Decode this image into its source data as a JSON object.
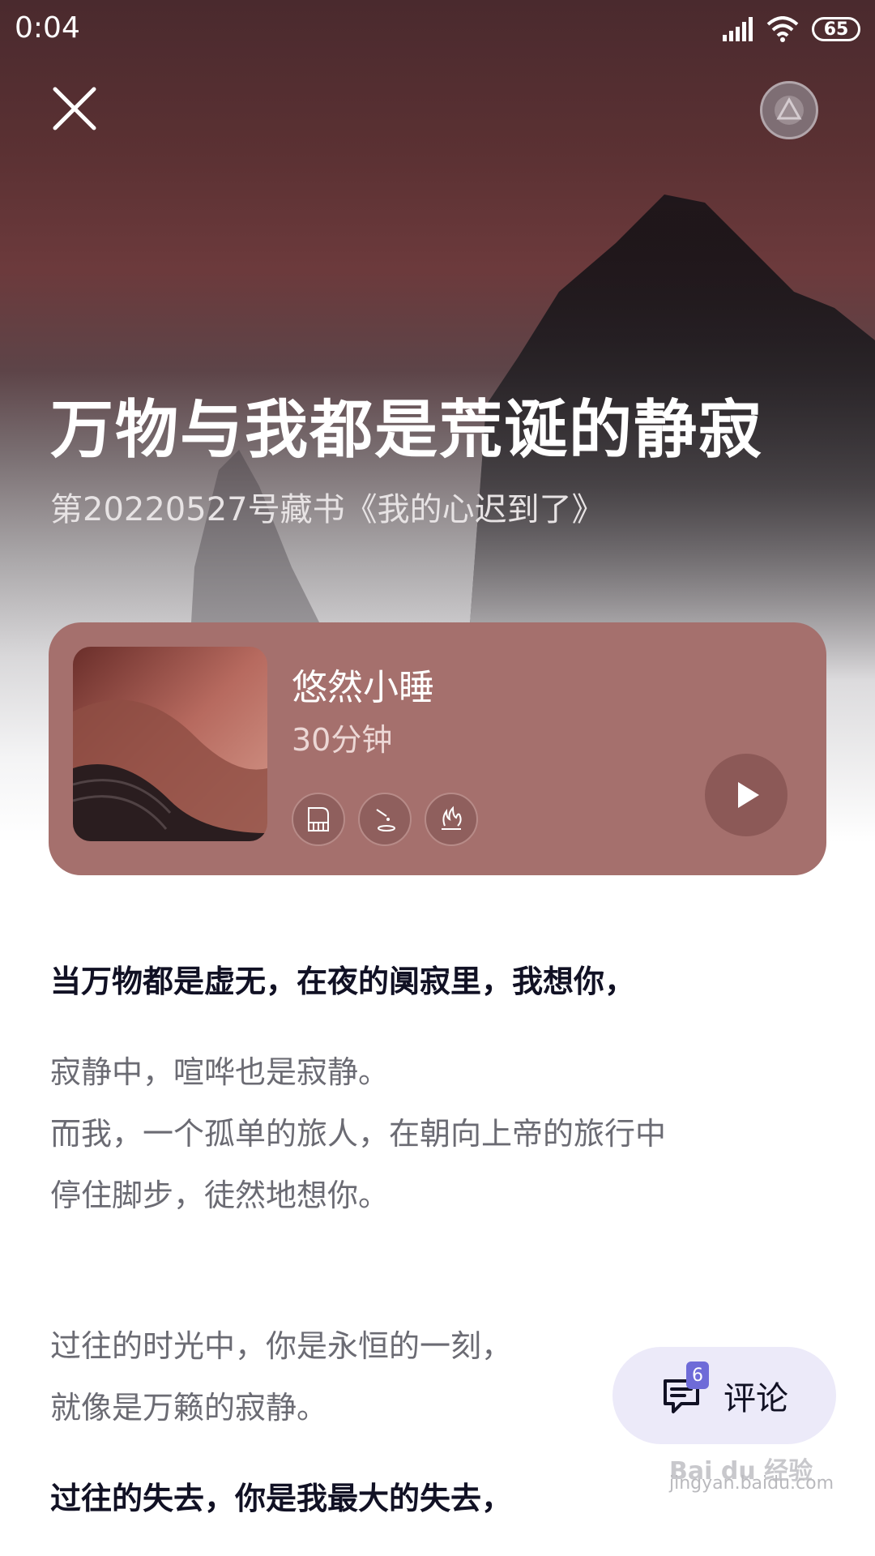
{
  "status_bar": {
    "time": "0:04",
    "battery": "65"
  },
  "article": {
    "title": "万物与我都是荒诞的静寂",
    "subtitle": "第20220527号藏书《我的心迟到了》"
  },
  "audio_card": {
    "name": "悠然小睡",
    "duration": "30分钟",
    "tag_icons": [
      "piano-icon",
      "water-drop-icon",
      "campfire-icon"
    ],
    "background_color": "#a5706d"
  },
  "body": {
    "line_1": "当万物都是虚无，在夜的阒寂里，我想你，",
    "line_2": "寂静中，喧哗也是寂静。",
    "line_3": "而我，一个孤单的旅人，在朝向上帝的旅行中",
    "line_4": "停住脚步，徒然地想你。",
    "line_5": "过往的时光中，你是永恒的一刻，",
    "line_6": "就像是万籁的寂静。",
    "line_7": "过往的失去，你是我最大的失去，"
  },
  "comment": {
    "label": "评论",
    "count": "6",
    "background_color": "#eceaf9"
  },
  "watermark": {
    "logo": "Bai du 经验",
    "url": "jingyan.baidu.com"
  }
}
